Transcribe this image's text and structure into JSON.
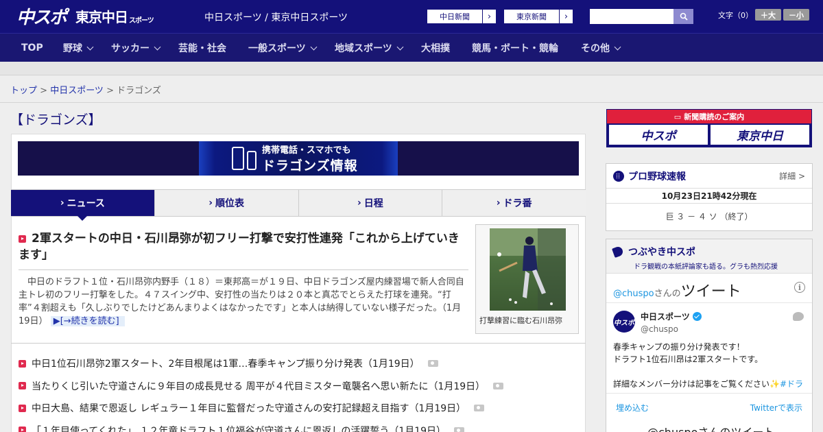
{
  "header": {
    "logo_chuspo": "中スポ",
    "logo_tokyo": "東京中日",
    "logo_tokyo_small": "スポーツ",
    "site_links": "中日スポーツ / 東京中日スポーツ",
    "paper_buttons": [
      "中日新聞",
      "東京新聞"
    ],
    "search_placeholder": "",
    "fontsize_label": "文字（0）",
    "font_large": "＋大",
    "font_small": "－小"
  },
  "nav": {
    "items": [
      {
        "label": "TOP",
        "chevron": false
      },
      {
        "label": "野球",
        "chevron": true
      },
      {
        "label": "サッカー",
        "chevron": true
      },
      {
        "label": "芸能・社会",
        "chevron": false
      },
      {
        "label": "一般スポーツ",
        "chevron": true
      },
      {
        "label": "地域スポーツ",
        "chevron": true
      },
      {
        "label": "大相撲",
        "chevron": false
      },
      {
        "label": "競馬・ボート・競輪",
        "chevron": false
      },
      {
        "label": "その他",
        "chevron": true
      }
    ]
  },
  "breadcrumb": {
    "top": "トップ",
    "sep": " > ",
    "parent": "中日スポーツ",
    "current": "ドラゴンズ"
  },
  "page_title": "【ドラゴンズ】",
  "banner": {
    "line1": "携帯電話・スマホでも",
    "line2": "ドラゴンズ情報"
  },
  "tabs": [
    "ニュース",
    "順位表",
    "日程",
    "ドラ番"
  ],
  "lead": {
    "title": "2軍スタートの中日・石川昂弥が初フリー打撃で安打性連発「これから上げていきます」",
    "body": "　中日のドラフト１位・石川昂弥内野手（１８）＝東邦高＝が１９日、中日ドラゴンズ屋内練習場で新人合同自主トレ初のフリー打撃をした。４７スイング中、安打性の当たりは２０本と真芯でとらえた打球を連発。“打率”４割超えも「久しぶりでしたけどあんまりよくはなかったです」と本人は納得していない様子だった。（1月19日）",
    "more": "[→続きを読む]",
    "photo_caption": "打撃練習に臨む石川昂弥"
  },
  "news": [
    "中日1位石川昂弥2軍スタート、2年目根尾は1軍…春季キャンプ振り分け発表（1月19日）",
    "当たりくじ引いた守道さんに９年目の成長見せる 周平が４代目ミスター竜襲名へ思い新たに（1月19日）",
    "中日大島、結果で恩返し レギュラー１年目に監督だった守道さんの安打記録超え目指す（1月19日）",
    "「１年目使ってくれた」 １２年竜ドラフト１位福谷が守道さんに恩返しの活躍誓う（1月19日）"
  ],
  "subscribe": {
    "head": "新聞購読のご案内",
    "logos": [
      "中スポ",
      "東京中日"
    ]
  },
  "score": {
    "title": "プロ野球速報",
    "more": "詳細 >",
    "time": "10月23日21時42分現在",
    "game": "巨 ３ － ４ ソ （終了）"
  },
  "tweets": {
    "title": "つぶやき中スポ",
    "subtitle": "ドラ観戦の本紙評論家も語る。グラも熱烈応援",
    "handle_at": "@chuspo",
    "san_no": "さんの",
    "tweet_word": "ツイート",
    "avatar_text": "中スポ",
    "name": "中日スポーツ",
    "user": "@chuspo",
    "text": "春季キャンプの振り分け発表です！\nドラフト1位石川昂は2軍スタートです。\n\n詳細なメンバー分けは記事をご覧ください✨",
    "hashtag": "#ドラ",
    "embed": "埋め込む",
    "view_on": "Twitterで表示",
    "bottom": "@chuspoさんのツイート"
  }
}
